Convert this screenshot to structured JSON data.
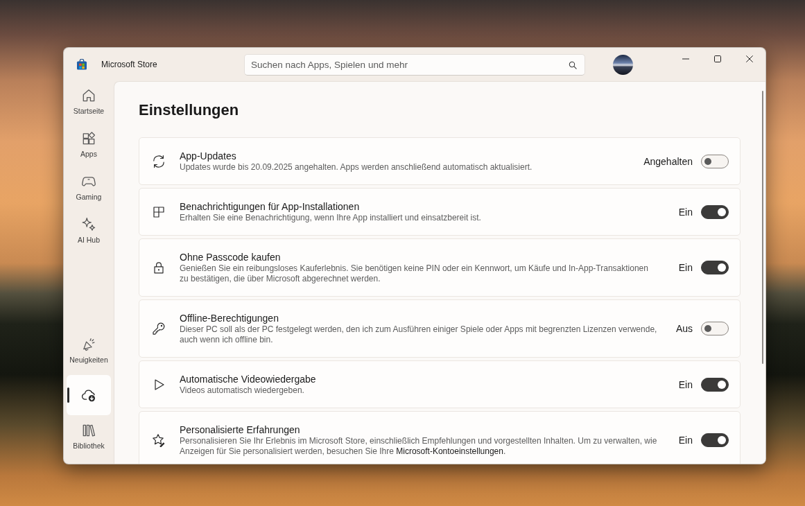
{
  "window": {
    "title": "Microsoft Store"
  },
  "search": {
    "placeholder": "Suchen nach Apps, Spielen und mehr"
  },
  "sidebar": {
    "items": [
      {
        "label": "Startseite",
        "selected": false
      },
      {
        "label": "Apps",
        "selected": false
      },
      {
        "label": "Gaming",
        "selected": false
      },
      {
        "label": "AI Hub",
        "selected": false
      }
    ],
    "bottom_items": [
      {
        "label": "Neuigkeiten",
        "selected": false
      },
      {
        "selected": true
      },
      {
        "label": "Bibliothek",
        "selected": false
      }
    ]
  },
  "page": {
    "heading": "Einstellungen",
    "settings": [
      {
        "title": "App-Updates",
        "description": "Updates wurde bis 20.09.2025 angehalten. Apps werden anschließend automatisch aktualisiert.",
        "status": "Angehalten",
        "on": false
      },
      {
        "title": "Benachrichtigungen für App-Installationen",
        "description": "Erhalten Sie eine Benachrichtigung, wenn Ihre App installiert und einsatzbereit ist.",
        "status": "Ein",
        "on": true
      },
      {
        "title": "Ohne Passcode kaufen",
        "description": "Genießen Sie ein reibungsloses Kauferlebnis. Sie benötigen keine PIN oder ein Kennwort, um Käufe und In-App-Transaktionen zu bestätigen, die über Microsoft abgerechnet werden.",
        "status": "Ein",
        "on": true
      },
      {
        "title": "Offline-Berechtigungen",
        "description": "Dieser PC soll als der PC festgelegt werden, den ich zum Ausführen einiger Spiele oder Apps mit begrenzten Lizenzen verwende, auch wenn ich offline bin.",
        "status": "Aus",
        "on": false
      },
      {
        "title": "Automatische Videowiedergabe",
        "description": "Videos automatisch wiedergeben.",
        "status": "Ein",
        "on": true
      },
      {
        "title": "Personalisierte Erfahrungen",
        "description": "Personalisieren Sie Ihr Erlebnis im Microsoft Store, einschließlich Empfehlungen und vorgestellten Inhalten. Um zu verwalten, wie Anzeigen für Sie personalisiert werden, besuchen Sie Ihre",
        "link": "Microsoft-Kontoeinstellungen",
        "description_end": ".",
        "status": "Ein",
        "on": true
      }
    ]
  }
}
